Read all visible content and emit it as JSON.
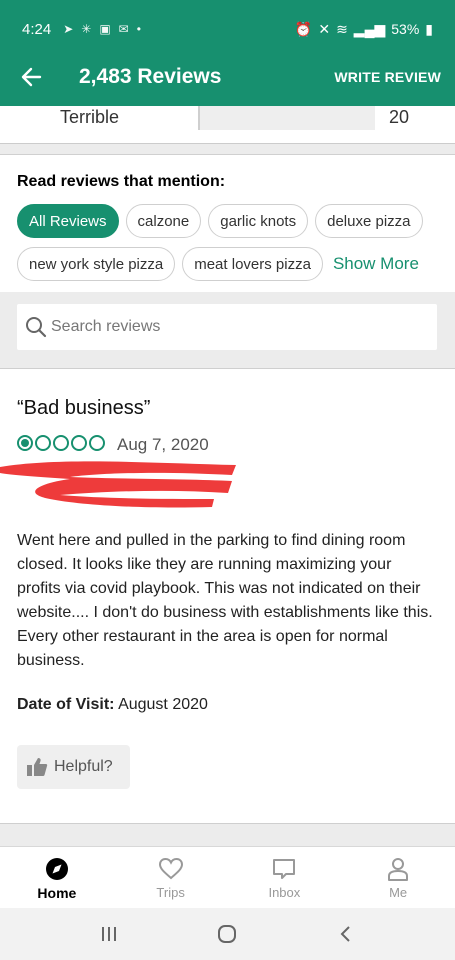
{
  "status_bar": {
    "time": "4:24",
    "battery": "53%"
  },
  "app_bar": {
    "title": "2,483 Reviews",
    "action": "WRITE REVIEW"
  },
  "rating_row": {
    "label": "Terrible",
    "count": "20",
    "fill_fraction": 0.01
  },
  "mentions": {
    "title": "Read reviews that mention:",
    "chips": [
      "All Reviews",
      "calzone",
      "garlic knots",
      "deluxe pizza",
      "new york style pizza",
      "meat lovers pizza"
    ],
    "show_more": "Show More"
  },
  "search": {
    "placeholder": "Search reviews"
  },
  "review": {
    "title": "“Bad business”",
    "bubble_rating": 1,
    "bubble_max": 5,
    "date": "Aug 7, 2020",
    "body": "Went here and pulled in the parking to find dining room closed.  It looks like they are running maximizing your profits via covid playbook.  This was not indicated on their website....  I don't do business with establishments like this.   Every other restaurant in the area is open for normal business.",
    "visit_label": "Date of Visit:",
    "visit_value": "August 2020",
    "helpful_label": "Helpful?"
  },
  "bottom_nav": {
    "items": [
      {
        "label": "Home",
        "icon": "compass-icon",
        "active": true
      },
      {
        "label": "Trips",
        "icon": "heart-icon",
        "active": false
      },
      {
        "label": "Inbox",
        "icon": "chat-icon",
        "active": false
      },
      {
        "label": "Me",
        "icon": "person-icon",
        "active": false
      }
    ]
  },
  "colors": {
    "brand_green": "#17906f",
    "redaction_red": "#ee3b3b"
  }
}
